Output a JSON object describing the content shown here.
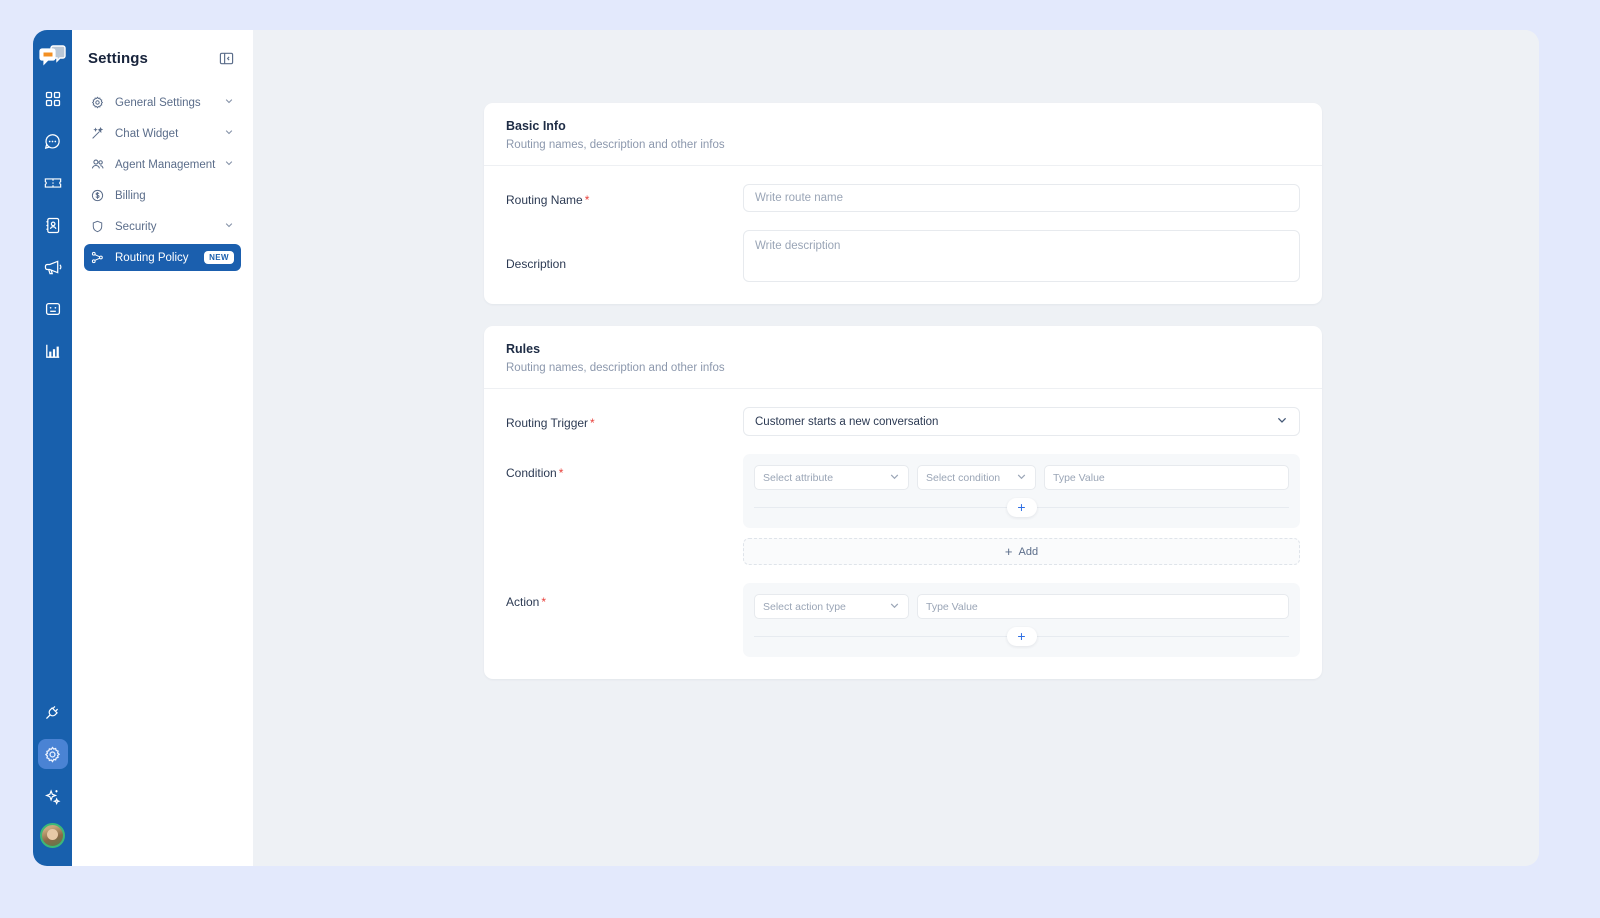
{
  "app": {
    "logo_icon": "chat-bubbles-logo"
  },
  "rail": {
    "items": [
      {
        "icon": "grid-dashboard-icon",
        "name": "dashboard"
      },
      {
        "icon": "chat-bubble-icon",
        "name": "conversations"
      },
      {
        "icon": "ticket-icon",
        "name": "tickets"
      },
      {
        "icon": "contacts-book-icon",
        "name": "contacts"
      },
      {
        "icon": "megaphone-icon",
        "name": "campaigns"
      },
      {
        "icon": "feedback-face-icon",
        "name": "feedback"
      },
      {
        "icon": "bar-chart-icon",
        "name": "reports"
      }
    ],
    "bottom": [
      {
        "icon": "plug-integration-icon",
        "name": "integrations",
        "active": false
      },
      {
        "icon": "gear-icon",
        "name": "settings",
        "active": true
      },
      {
        "icon": "sparkles-icon",
        "name": "ai-assistant",
        "active": false
      }
    ],
    "avatar": {
      "icon": "avatar",
      "status_color": "#3cb878"
    }
  },
  "sidebar": {
    "title": "Settings",
    "collapse_icon": "panel-collapse-icon",
    "items": [
      {
        "label": "General Settings",
        "icon": "gear-outline-icon",
        "chevron": true,
        "active": false,
        "badge": ""
      },
      {
        "label": "Chat Widget",
        "icon": "magic-wand-icon",
        "chevron": true,
        "active": false,
        "badge": ""
      },
      {
        "label": "Agent Management",
        "icon": "users-icon",
        "chevron": true,
        "active": false,
        "badge": ""
      },
      {
        "label": "Billing",
        "icon": "dollar-circle-icon",
        "chevron": false,
        "active": false,
        "badge": ""
      },
      {
        "label": "Security",
        "icon": "shield-icon",
        "chevron": true,
        "active": false,
        "badge": ""
      },
      {
        "label": "Routing Policy",
        "icon": "routing-nodes-icon",
        "chevron": false,
        "active": true,
        "badge": "NEW"
      }
    ]
  },
  "basic_info": {
    "title": "Basic Info",
    "subtitle": "Routing names, description and other infos",
    "routing_name_label": "Routing Name",
    "routing_name_value": "",
    "routing_name_placeholder": "Write route name",
    "description_label": "Description",
    "description_value": "",
    "description_placeholder": "Write description"
  },
  "rules": {
    "title": "Rules",
    "subtitle": "Routing names, description and other infos",
    "trigger_label": "Routing Trigger",
    "trigger_value": "Customer starts a new conversation",
    "condition_label": "Condition",
    "condition_attribute_placeholder": "Select attribute",
    "condition_operator_placeholder": "Select condition",
    "condition_value_placeholder": "Type Value",
    "condition_add_row_icon": "plus-icon",
    "add_button_label": "Add",
    "add_button_icon": "plus-icon",
    "action_label": "Action",
    "action_type_placeholder": "Select action type",
    "action_value_placeholder": "Type Value",
    "action_add_row_icon": "plus-icon"
  },
  "colors": {
    "brand_blue": "#1860ad",
    "active_nav": "#1b5fae",
    "accent_plus": "#2f6fe4",
    "required_red": "#e8413c",
    "page_bg": "#e3e9fc",
    "content_bg": "#eef1f5"
  }
}
